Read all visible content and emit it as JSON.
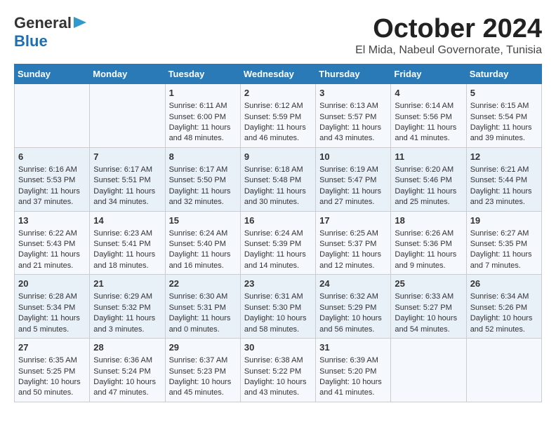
{
  "logo": {
    "line1": "General",
    "line2": "Blue"
  },
  "title": "October 2024",
  "location": "El Mida, Nabeul Governorate, Tunisia",
  "days_header": [
    "Sunday",
    "Monday",
    "Tuesday",
    "Wednesday",
    "Thursday",
    "Friday",
    "Saturday"
  ],
  "weeks": [
    [
      {
        "day": "",
        "sunrise": "",
        "sunset": "",
        "daylight": ""
      },
      {
        "day": "",
        "sunrise": "",
        "sunset": "",
        "daylight": ""
      },
      {
        "day": "1",
        "sunrise": "Sunrise: 6:11 AM",
        "sunset": "Sunset: 6:00 PM",
        "daylight": "Daylight: 11 hours and 48 minutes."
      },
      {
        "day": "2",
        "sunrise": "Sunrise: 6:12 AM",
        "sunset": "Sunset: 5:59 PM",
        "daylight": "Daylight: 11 hours and 46 minutes."
      },
      {
        "day": "3",
        "sunrise": "Sunrise: 6:13 AM",
        "sunset": "Sunset: 5:57 PM",
        "daylight": "Daylight: 11 hours and 43 minutes."
      },
      {
        "day": "4",
        "sunrise": "Sunrise: 6:14 AM",
        "sunset": "Sunset: 5:56 PM",
        "daylight": "Daylight: 11 hours and 41 minutes."
      },
      {
        "day": "5",
        "sunrise": "Sunrise: 6:15 AM",
        "sunset": "Sunset: 5:54 PM",
        "daylight": "Daylight: 11 hours and 39 minutes."
      }
    ],
    [
      {
        "day": "6",
        "sunrise": "Sunrise: 6:16 AM",
        "sunset": "Sunset: 5:53 PM",
        "daylight": "Daylight: 11 hours and 37 minutes."
      },
      {
        "day": "7",
        "sunrise": "Sunrise: 6:17 AM",
        "sunset": "Sunset: 5:51 PM",
        "daylight": "Daylight: 11 hours and 34 minutes."
      },
      {
        "day": "8",
        "sunrise": "Sunrise: 6:17 AM",
        "sunset": "Sunset: 5:50 PM",
        "daylight": "Daylight: 11 hours and 32 minutes."
      },
      {
        "day": "9",
        "sunrise": "Sunrise: 6:18 AM",
        "sunset": "Sunset: 5:48 PM",
        "daylight": "Daylight: 11 hours and 30 minutes."
      },
      {
        "day": "10",
        "sunrise": "Sunrise: 6:19 AM",
        "sunset": "Sunset: 5:47 PM",
        "daylight": "Daylight: 11 hours and 27 minutes."
      },
      {
        "day": "11",
        "sunrise": "Sunrise: 6:20 AM",
        "sunset": "Sunset: 5:46 PM",
        "daylight": "Daylight: 11 hours and 25 minutes."
      },
      {
        "day": "12",
        "sunrise": "Sunrise: 6:21 AM",
        "sunset": "Sunset: 5:44 PM",
        "daylight": "Daylight: 11 hours and 23 minutes."
      }
    ],
    [
      {
        "day": "13",
        "sunrise": "Sunrise: 6:22 AM",
        "sunset": "Sunset: 5:43 PM",
        "daylight": "Daylight: 11 hours and 21 minutes."
      },
      {
        "day": "14",
        "sunrise": "Sunrise: 6:23 AM",
        "sunset": "Sunset: 5:41 PM",
        "daylight": "Daylight: 11 hours and 18 minutes."
      },
      {
        "day": "15",
        "sunrise": "Sunrise: 6:24 AM",
        "sunset": "Sunset: 5:40 PM",
        "daylight": "Daylight: 11 hours and 16 minutes."
      },
      {
        "day": "16",
        "sunrise": "Sunrise: 6:24 AM",
        "sunset": "Sunset: 5:39 PM",
        "daylight": "Daylight: 11 hours and 14 minutes."
      },
      {
        "day": "17",
        "sunrise": "Sunrise: 6:25 AM",
        "sunset": "Sunset: 5:37 PM",
        "daylight": "Daylight: 11 hours and 12 minutes."
      },
      {
        "day": "18",
        "sunrise": "Sunrise: 6:26 AM",
        "sunset": "Sunset: 5:36 PM",
        "daylight": "Daylight: 11 hours and 9 minutes."
      },
      {
        "day": "19",
        "sunrise": "Sunrise: 6:27 AM",
        "sunset": "Sunset: 5:35 PM",
        "daylight": "Daylight: 11 hours and 7 minutes."
      }
    ],
    [
      {
        "day": "20",
        "sunrise": "Sunrise: 6:28 AM",
        "sunset": "Sunset: 5:34 PM",
        "daylight": "Daylight: 11 hours and 5 minutes."
      },
      {
        "day": "21",
        "sunrise": "Sunrise: 6:29 AM",
        "sunset": "Sunset: 5:32 PM",
        "daylight": "Daylight: 11 hours and 3 minutes."
      },
      {
        "day": "22",
        "sunrise": "Sunrise: 6:30 AM",
        "sunset": "Sunset: 5:31 PM",
        "daylight": "Daylight: 11 hours and 0 minutes."
      },
      {
        "day": "23",
        "sunrise": "Sunrise: 6:31 AM",
        "sunset": "Sunset: 5:30 PM",
        "daylight": "Daylight: 10 hours and 58 minutes."
      },
      {
        "day": "24",
        "sunrise": "Sunrise: 6:32 AM",
        "sunset": "Sunset: 5:29 PM",
        "daylight": "Daylight: 10 hours and 56 minutes."
      },
      {
        "day": "25",
        "sunrise": "Sunrise: 6:33 AM",
        "sunset": "Sunset: 5:27 PM",
        "daylight": "Daylight: 10 hours and 54 minutes."
      },
      {
        "day": "26",
        "sunrise": "Sunrise: 6:34 AM",
        "sunset": "Sunset: 5:26 PM",
        "daylight": "Daylight: 10 hours and 52 minutes."
      }
    ],
    [
      {
        "day": "27",
        "sunrise": "Sunrise: 6:35 AM",
        "sunset": "Sunset: 5:25 PM",
        "daylight": "Daylight: 10 hours and 50 minutes."
      },
      {
        "day": "28",
        "sunrise": "Sunrise: 6:36 AM",
        "sunset": "Sunset: 5:24 PM",
        "daylight": "Daylight: 10 hours and 47 minutes."
      },
      {
        "day": "29",
        "sunrise": "Sunrise: 6:37 AM",
        "sunset": "Sunset: 5:23 PM",
        "daylight": "Daylight: 10 hours and 45 minutes."
      },
      {
        "day": "30",
        "sunrise": "Sunrise: 6:38 AM",
        "sunset": "Sunset: 5:22 PM",
        "daylight": "Daylight: 10 hours and 43 minutes."
      },
      {
        "day": "31",
        "sunrise": "Sunrise: 6:39 AM",
        "sunset": "Sunset: 5:20 PM",
        "daylight": "Daylight: 10 hours and 41 minutes."
      },
      {
        "day": "",
        "sunrise": "",
        "sunset": "",
        "daylight": ""
      },
      {
        "day": "",
        "sunrise": "",
        "sunset": "",
        "daylight": ""
      }
    ]
  ]
}
